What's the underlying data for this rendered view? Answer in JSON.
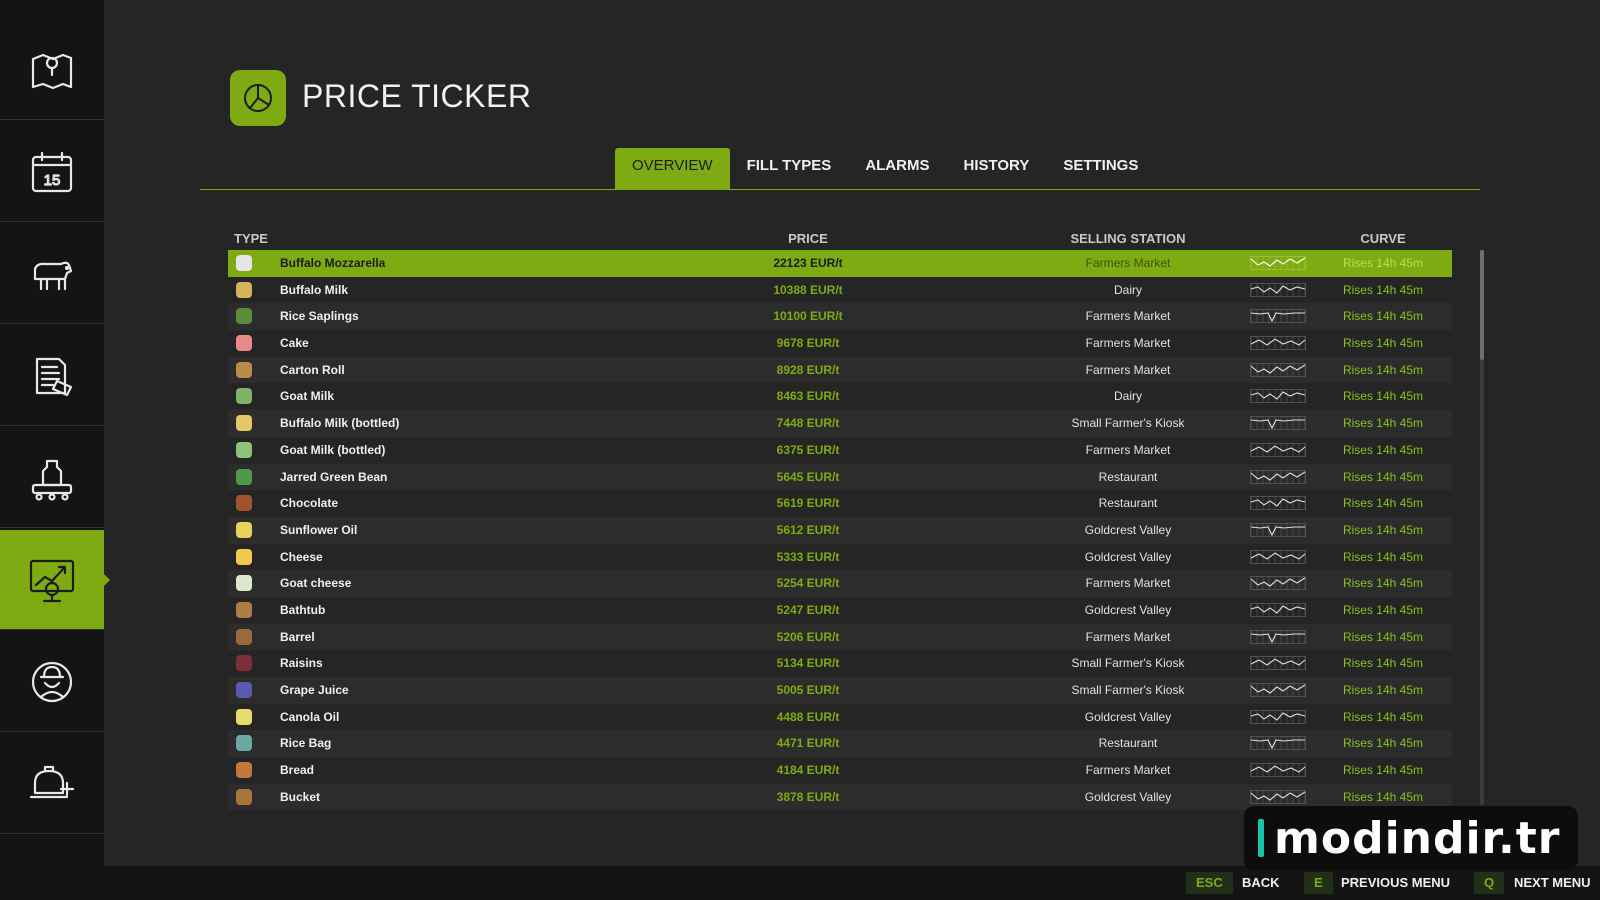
{
  "sidebar": {
    "items": [
      {
        "name": "map-icon",
        "active": false
      },
      {
        "name": "calendar-icon",
        "active": false
      },
      {
        "name": "cow-icon",
        "active": false
      },
      {
        "name": "contracts-icon",
        "active": false
      },
      {
        "name": "production-icon",
        "active": false
      },
      {
        "name": "price-chart-icon",
        "active": true
      },
      {
        "name": "farmer-icon",
        "active": false
      },
      {
        "name": "help-icon",
        "active": false
      }
    ]
  },
  "header": {
    "title": "PRICE TICKER",
    "icon": "pie-chart-icon"
  },
  "tabs": [
    {
      "label": "OVERVIEW",
      "active": true
    },
    {
      "label": "FILL TYPES",
      "active": false
    },
    {
      "label": "ALARMS",
      "active": false
    },
    {
      "label": "HISTORY",
      "active": false
    },
    {
      "label": "SETTINGS",
      "active": false
    }
  ],
  "table": {
    "columns": {
      "type": "TYPE",
      "price": "PRICE",
      "station": "SELLING STATION",
      "curve": "CURVE"
    },
    "selected_index": 0,
    "rows": [
      {
        "name": "Buffalo Mozzarella",
        "price": "22123 EUR/t",
        "station": "Farmers Market",
        "trend": "Rises 14h 45m",
        "icon_color": "#e6e6e6"
      },
      {
        "name": "Buffalo Milk",
        "price": "10388 EUR/t",
        "station": "Dairy",
        "trend": "Rises 14h 45m",
        "icon_color": "#d9b35a"
      },
      {
        "name": "Rice Saplings",
        "price": "10100 EUR/t",
        "station": "Farmers Market",
        "trend": "Rises 14h 45m",
        "icon_color": "#5a8c3a"
      },
      {
        "name": "Cake",
        "price": "9678 EUR/t",
        "station": "Farmers Market",
        "trend": "Rises 14h 45m",
        "icon_color": "#e88a8a"
      },
      {
        "name": "Carton Roll",
        "price": "8928 EUR/t",
        "station": "Farmers Market",
        "trend": "Rises 14h 45m",
        "icon_color": "#b98a4a"
      },
      {
        "name": "Goat Milk",
        "price": "8463 EUR/t",
        "station": "Dairy",
        "trend": "Rises 14h 45m",
        "icon_color": "#7fb36a"
      },
      {
        "name": "Buffalo Milk (bottled)",
        "price": "7448 EUR/t",
        "station": "Small Farmer's Kiosk",
        "trend": "Rises 14h 45m",
        "icon_color": "#e3c86a"
      },
      {
        "name": "Goat Milk (bottled)",
        "price": "6375 EUR/t",
        "station": "Farmers Market",
        "trend": "Rises 14h 45m",
        "icon_color": "#8cc27a"
      },
      {
        "name": "Jarred Green Bean",
        "price": "5645 EUR/t",
        "station": "Restaurant",
        "trend": "Rises 14h 45m",
        "icon_color": "#4f9a4a"
      },
      {
        "name": "Chocolate",
        "price": "5619 EUR/t",
        "station": "Restaurant",
        "trend": "Rises 14h 45m",
        "icon_color": "#a0522d"
      },
      {
        "name": "Sunflower Oil",
        "price": "5612 EUR/t",
        "station": "Goldcrest Valley",
        "trend": "Rises 14h 45m",
        "icon_color": "#e8d25a"
      },
      {
        "name": "Cheese",
        "price": "5333 EUR/t",
        "station": "Goldcrest Valley",
        "trend": "Rises 14h 45m",
        "icon_color": "#f2c94c"
      },
      {
        "name": "Goat cheese",
        "price": "5254 EUR/t",
        "station": "Farmers Market",
        "trend": "Rises 14h 45m",
        "icon_color": "#dfe6d0"
      },
      {
        "name": "Bathtub",
        "price": "5247 EUR/t",
        "station": "Goldcrest Valley",
        "trend": "Rises 14h 45m",
        "icon_color": "#b07a45"
      },
      {
        "name": "Barrel",
        "price": "5206 EUR/t",
        "station": "Farmers Market",
        "trend": "Rises 14h 45m",
        "icon_color": "#9a6a3a"
      },
      {
        "name": "Raisins",
        "price": "5134 EUR/t",
        "station": "Small Farmer's Kiosk",
        "trend": "Rises 14h 45m",
        "icon_color": "#7a2f3a"
      },
      {
        "name": "Grape Juice",
        "price": "5005 EUR/t",
        "station": "Small Farmer's Kiosk",
        "trend": "Rises 14h 45m",
        "icon_color": "#5a5ab0"
      },
      {
        "name": "Canola Oil",
        "price": "4488 EUR/t",
        "station": "Goldcrest Valley",
        "trend": "Rises 14h 45m",
        "icon_color": "#e6dc6a"
      },
      {
        "name": "Rice Bag",
        "price": "4471 EUR/t",
        "station": "Restaurant",
        "trend": "Rises 14h 45m",
        "icon_color": "#6aa8a0"
      },
      {
        "name": "Bread",
        "price": "4184 EUR/t",
        "station": "Farmers Market",
        "trend": "Rises 14h 45m",
        "icon_color": "#c2783a"
      },
      {
        "name": "Bucket",
        "price": "3878 EUR/t",
        "station": "Goldcrest Valley",
        "trend": "Rises 14h 45m",
        "icon_color": "#a8743a"
      }
    ]
  },
  "footer": [
    {
      "key": "ESC",
      "label": "BACK"
    },
    {
      "key": "E",
      "label": "PREVIOUS MENU"
    },
    {
      "key": "Q",
      "label": "NEXT MENU"
    }
  ],
  "watermark": "modindir.tr",
  "colors": {
    "accent": "#7fab12",
    "background": "#252525",
    "sidebar": "#141414"
  }
}
